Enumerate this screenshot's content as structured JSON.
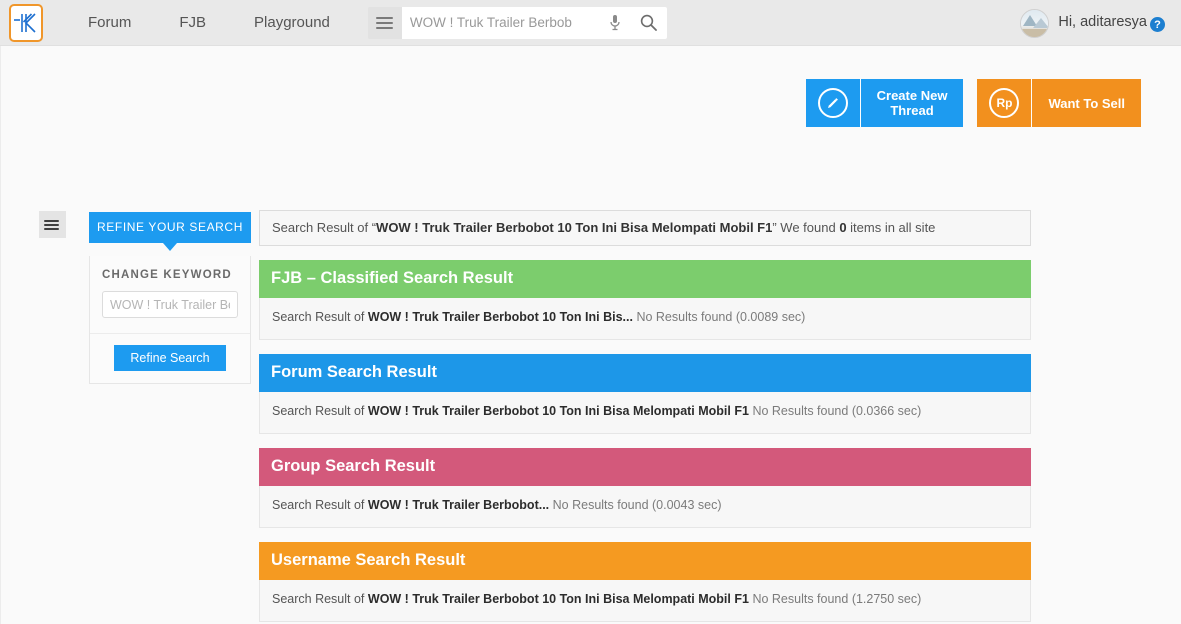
{
  "header": {
    "logo_alt": "kaskus-logo",
    "nav": [
      {
        "label": "Forum"
      },
      {
        "label": "FJB"
      },
      {
        "label": "Playground"
      }
    ],
    "search": {
      "category_icon": "hamburger-icon",
      "value": "",
      "placeholder": "WOW ! Truk Trailer Berbob",
      "mic_icon": "microphone-icon",
      "search_icon": "magnifier-icon"
    },
    "user": {
      "greeting": "Hi, aditaresya",
      "help_symbol": "?",
      "avatar_alt": "user-avatar"
    }
  },
  "actions": [
    {
      "id": "create-new-thread",
      "label": "Create New\nThread",
      "icon": "pencil-icon",
      "color": "#1d9bf0"
    },
    {
      "id": "want-to-sell",
      "label": "Want To Sell",
      "icon": "rupiah-icon",
      "icon_text": "Rp",
      "color": "#f2901e"
    }
  ],
  "sidebar": {
    "toggle_icon": "hamburger-icon",
    "tab_label": "REFINE YOUR SEARCH",
    "change_keyword_label": "CHANGE KEYWORD",
    "keyword_value": "",
    "keyword_placeholder": "WOW ! Truk Trailer Be",
    "refine_button": "Refine Search"
  },
  "summary": {
    "prefix": "Search Result of “",
    "query": "WOW ! Truk Trailer Berbobot 10 Ton Ini Bisa Melompati Mobil F1",
    "middle": "” We found ",
    "count": "0",
    "suffix": " items in all site"
  },
  "sections": [
    {
      "id": "fjb",
      "title": "FJB – Classified Search Result",
      "color": "#7ccd6d",
      "result_prefix": "Search Result of ",
      "result_query": "WOW ! Truk Trailer Berbobot 10 Ton Ini Bis...",
      "result_status": "No Results found",
      "result_time": "(0.0089 sec)"
    },
    {
      "id": "forum",
      "title": "Forum Search Result",
      "color": "#1d97e8",
      "result_prefix": "Search Result of ",
      "result_query": "WOW ! Truk Trailer Berbobot 10 Ton Ini Bisa Melompati Mobil F1",
      "result_status": "No Results found",
      "result_time": "(0.0366 sec)"
    },
    {
      "id": "group",
      "title": "Group Search Result",
      "color": "#d3597b",
      "result_prefix": "Search Result of ",
      "result_query": "WOW ! Truk Trailer Berbobot...",
      "result_status": "No Results found",
      "result_time": "(0.0043 sec)"
    },
    {
      "id": "username",
      "title": "Username Search Result",
      "color": "#f59a21",
      "result_prefix": "Search Result of ",
      "result_query": "WOW ! Truk Trailer Berbobot 10 Ton Ini Bisa Melompati Mobil F1",
      "result_status": "No Results found",
      "result_time": "(1.2750 sec)"
    }
  ]
}
